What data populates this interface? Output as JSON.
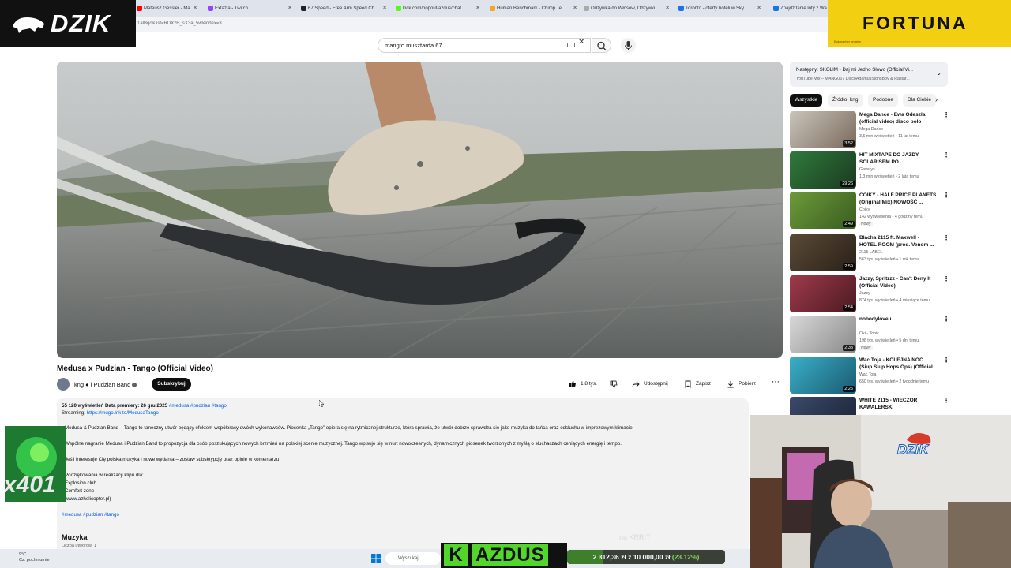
{
  "browser": {
    "tabs": [
      {
        "label": "Mateusz Gessler - Ma",
        "color": "#ff0000"
      },
      {
        "label": "Extazja - Twitch",
        "color": "#9146ff"
      },
      {
        "label": "67 Speed - Free Arm Speed Ch",
        "color": "#222222"
      },
      {
        "label": "kick.com/popout/azdus/chat",
        "color": "#53fc18"
      },
      {
        "label": "Human Benchmark - Chimp Te",
        "color": "#f5a623"
      },
      {
        "label": "Odżywka do Włosów, Odżywki",
        "color": "#aaaaaa"
      },
      {
        "label": "Toronto - oferty hoteli w Sky",
        "color": "#1a73e8"
      },
      {
        "label": "Znajdź tanie loty z Wa",
        "color": "#1a73e8"
      }
    ],
    "url_fragment": "1alBqo&list=RDXzH_sX3a_5w&index=3"
  },
  "overlays": {
    "dzik_logo": "DZIK",
    "fortuna_logo": "FORTUNA",
    "fortuna_small": "Bukmacher legalny",
    "green_counter": "x401",
    "kazdus_k": "K",
    "kazdus_name": "AZDUS",
    "donation_prefix": "2 312,36 zł",
    "donation_mid": "z 10 000,00 zł",
    "donation_percent": "(23.12%)",
    "donation_fraction": 0.2312,
    "nakrrit": "na KRRIT",
    "webcam_logo": "DZIK"
  },
  "search": {
    "value": "mangto musztarda 67"
  },
  "video": {
    "title": "Medusa x Pudzian - Tango (Official Video)",
    "channel": "kng ● i Pudzian Band",
    "subscribe_label": "Subskrybuj",
    "likes": "1,8 tys.",
    "share_label": "Udostępnij",
    "save_label": "Zapisz",
    "download_label": "Pobierz"
  },
  "description": {
    "meta": "55 120 wyświetleń  Data premiery: 26 gru 2025",
    "meta_tags": "#medusa #pudzian #tango",
    "streaming_label": "Streaming:",
    "streaming_link": "https://mugo.lnk.to/MedusaTango",
    "p1": "Medusa & Pudzian Band – Tango to taneczny utwór będący efektem współpracy dwóch wykonawców. Piosenka „Tango” opiera się na rytmicznej strukturze, która sprawia, że utwór dobrze sprawdza się jako muzyka do tańca oraz odsłuchu w imprezowym klimacie.",
    "p2": "Wspólne nagranie Medusa i Pudzian Band to propozycja dla osób poszukujących nowych brzmień na polskiej scenie muzycznej. Tango wpisuje się w nurt nowoczesnych, dynamicznych piosenek tworzonych z myślą o słuchaczach ceniących energię i tempo.",
    "p3": "Jeśli interesuje Cię polska muzyka i nowe wydania – zostaw subskrypcję oraz opinię w komentarzu.",
    "p4": "Podziękowania w realizacji klipu dla:",
    "p5": "Explosion club",
    "p6": "Comfort zone",
    "p7": "(www.azhelicopter.pl)",
    "tags2": "#medusa #pudzian #tango",
    "music_heading": "Muzyka",
    "music_sub": "Liczba utworów: 1"
  },
  "sidebar": {
    "next_title": "Następny: SKOLIM - Daj mi Jedno Słowo (Official Vi...",
    "next_sub": "YouTube Mix – MANG067 DiscoAdamusSignsBoy & Rastaf...",
    "chips": [
      "Wszystkie",
      "Źródło: kng",
      "Podobne",
      "Dla Ciebie"
    ],
    "recs": [
      {
        "title": "Mega Dance - Ewa Odeszła (official video) disco polo",
        "channel": "Mega Dance",
        "views": "3,5 mln wyświetleń • 11 lat temu",
        "duration": "3:52",
        "badge": "",
        "c1": "#c9c4bb",
        "c2": "#7a6a5a"
      },
      {
        "title": "HIT MIXTAPE DO JAZDY SOLARISEM PO ...",
        "channel": "Gavarys",
        "views": "1,3 mln wyświetleń • 2 lata temu",
        "duration": "29:26",
        "badge": "",
        "c1": "#2f7a3b",
        "c2": "#1b3a20"
      },
      {
        "title": "COIKY - HALF PRICE PLANETS (Original Mix) NOWOŚĆ ...",
        "channel": "Coiky",
        "views": "142 wyświetlenia • 4 godziny temu",
        "duration": "2:49",
        "badge": "Nowy",
        "c1": "#6c9b3a",
        "c2": "#3a5c20"
      },
      {
        "title": "Blacha 2115 ft. Maxwell - HOTEL ROOM (prod. Venom ...",
        "channel": "2115 LABEL",
        "views": "563 tys. wyświetleń • 1 rok temu",
        "duration": "2:59",
        "badge": "",
        "c1": "#5a4a36",
        "c2": "#2a2018"
      },
      {
        "title": "Jazzy, Spritzzz - Can't Deny It (Official Video)",
        "channel": "Jazzy",
        "views": "874 tys. wyświetleń • 4 miesiące temu",
        "duration": "2:54",
        "badge": "",
        "c1": "#a03a4a",
        "c2": "#4a1a22"
      },
      {
        "title": "nobodyloveu",
        "channel": "Oki - Topic",
        "views": "198 tys. wyświetleń • 5 dni temu",
        "duration": "2:33",
        "badge": "Nowy",
        "c1": "#d8d8d8",
        "c2": "#8a8a8a"
      },
      {
        "title": "Wac Toja - KOLEJNA NOC (Siup Siup Hops Ops) (Official Video)",
        "channel": "Wac Toja",
        "views": "650 tys. wyświetleń • 2 tygodnie temu",
        "duration": "2:25",
        "badge": "",
        "c1": "#3ab0c8",
        "c2": "#1a5a70"
      },
      {
        "title": "WHITE 2115 - WIECZÓR KAWALERSKI",
        "channel": "",
        "views": "",
        "duration": "",
        "badge": "",
        "c1": "#3a4a6a",
        "c2": "#1a2233"
      }
    ]
  },
  "taskbar": {
    "temp": "9°C",
    "weather": "Cz. pochmurnie",
    "search": "Wyszukaj"
  },
  "colors": {
    "yt_red": "#ff0000",
    "link": "#065fd4",
    "fortuna": "#f3cf12",
    "kick_green": "#52d62a"
  }
}
